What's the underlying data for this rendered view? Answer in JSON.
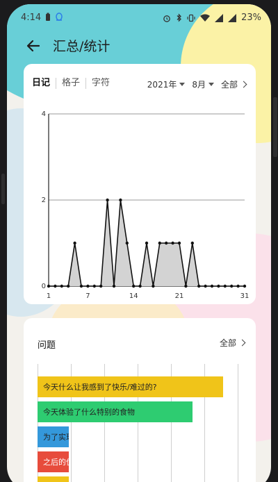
{
  "status": {
    "time": "4:14",
    "battery": "23%"
  },
  "appbar": {
    "title": "汇总/统计"
  },
  "stats_card": {
    "tabs": [
      "日记",
      "格子",
      "字符"
    ],
    "year": "2021年",
    "month": "8月",
    "all": "全部"
  },
  "chart_data": {
    "type": "area",
    "x": [
      1,
      2,
      3,
      4,
      5,
      6,
      7,
      8,
      9,
      10,
      11,
      12,
      13,
      14,
      15,
      16,
      17,
      18,
      19,
      20,
      21,
      22,
      23,
      24,
      25,
      26,
      27,
      28,
      29,
      30,
      31
    ],
    "values": [
      0,
      0,
      0,
      0,
      1,
      0,
      0,
      0,
      0,
      2,
      0,
      2,
      1,
      0,
      0,
      1,
      0,
      1,
      1,
      1,
      1,
      0,
      1,
      0,
      0,
      0,
      0,
      0,
      0,
      0,
      0
    ],
    "xticks": [
      "1",
      "7",
      "14",
      "21",
      "31"
    ],
    "xtick_values": [
      1,
      7,
      14,
      21,
      31
    ],
    "yticks": [
      "0",
      "2",
      "4"
    ],
    "ylim": [
      0,
      4
    ],
    "xlim": [
      1,
      31
    ],
    "grid": true,
    "fill_color": "#d3d3d3",
    "line_color": "#111111"
  },
  "questions_card": {
    "title": "问题",
    "all": "全部",
    "bars": [
      {
        "label": "今天什么让我感到了快乐/难过的?",
        "fraction": 0.92,
        "color": "#f0c419",
        "dark_text": true
      },
      {
        "label": "今天体验了什么特别的食物",
        "fraction": 0.77,
        "color": "#2ecc71",
        "dark_text": true
      },
      {
        "label": "为了实现梦想我做了什么?",
        "fraction": 0.155,
        "color": "#3498db",
        "dark_text": true
      },
      {
        "label": "之后的优化之路",
        "fraction": 0.155,
        "color": "#e74c3c",
        "dark_text": false
      },
      {
        "label": "",
        "fraction": 0.155,
        "color": "#f0c419",
        "dark_text": true
      }
    ]
  }
}
